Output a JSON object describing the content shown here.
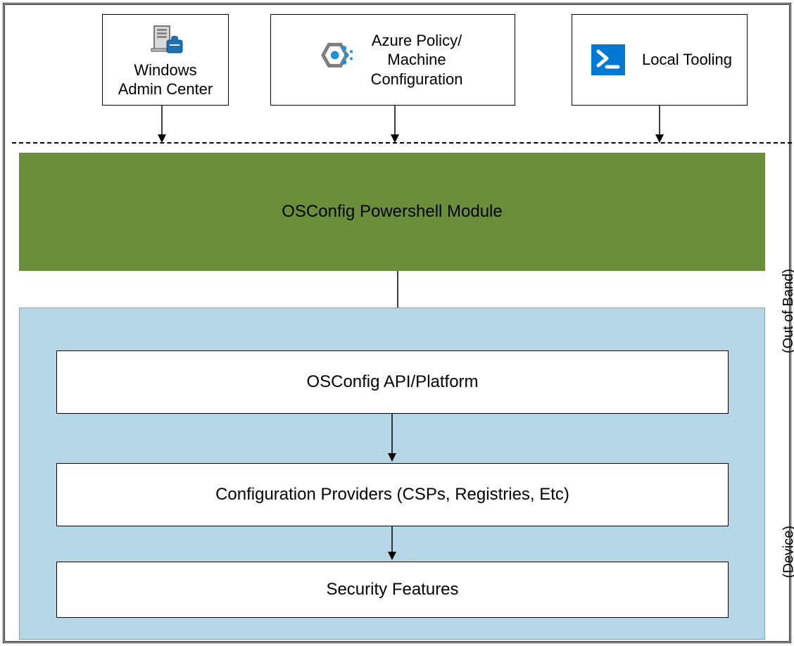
{
  "top": {
    "wac": {
      "label1": "Windows",
      "label2": "Admin Center",
      "icon": "server-toolbox-icon"
    },
    "azure": {
      "label1": "Azure Policy/",
      "label2": "Machine",
      "label3": "Configuration",
      "icon": "policy-hex-icon"
    },
    "local": {
      "label": "Local Tooling",
      "icon": "powershell-icon"
    }
  },
  "osconfig_ps": "OSConfig Powershell Module",
  "side": {
    "oob": "(Out of Band)",
    "device": "(Device)"
  },
  "device": {
    "api": "OSConfig API/Platform",
    "csp": "Configuration Providers (CSPs, Registries, Etc)",
    "sec": "Security Features"
  },
  "colors": {
    "olive": "#6b8e3a",
    "lightblue": "#b5d6e4",
    "ps_blue": "#0078d4"
  }
}
